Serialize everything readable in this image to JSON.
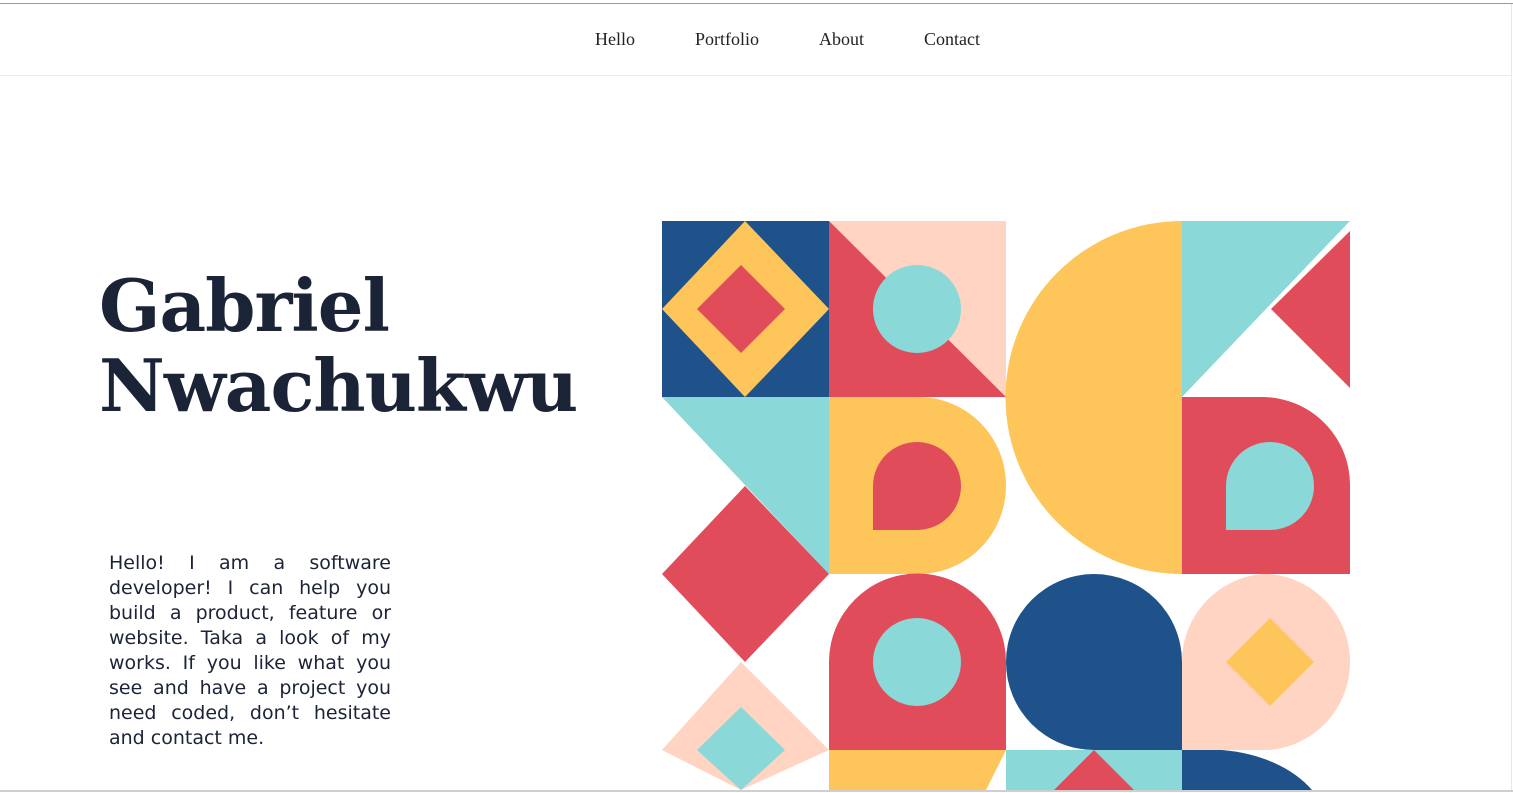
{
  "nav": {
    "items": [
      {
        "label": "Hello"
      },
      {
        "label": "Portfolio"
      },
      {
        "label": "About"
      },
      {
        "label": "Contact"
      }
    ]
  },
  "hero": {
    "name_first": "Gabriel",
    "name_last": "Nwachukwu",
    "intro": "Hello! I am a software developer! I can help you build a product, feature or website. Taka a look of my works. If you like what you see and have a project you need coded, don’t hesitate and contact me."
  },
  "palette": {
    "navy": "#1f528a",
    "yellow": "#fec55a",
    "red": "#e14c5a",
    "aqua": "#8ad8d8",
    "peach": "#ffd4c2",
    "text": "#1b2337"
  }
}
